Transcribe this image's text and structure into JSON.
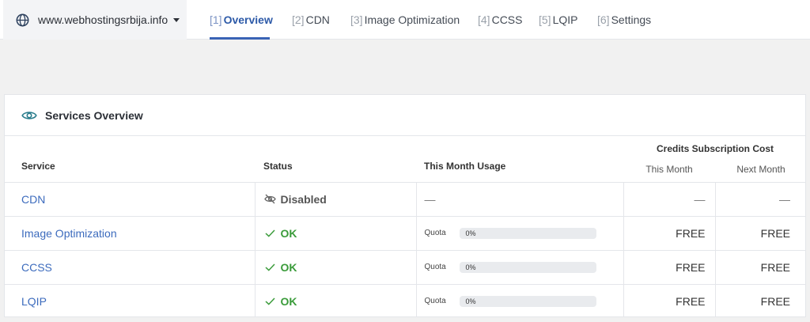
{
  "site": {
    "domain": "www.webhostingsrbija.info",
    "icon": "globe-icon"
  },
  "tabs": [
    {
      "num": "[1]",
      "label": "Overview",
      "active": true
    },
    {
      "num": "[2]",
      "label": "CDN"
    },
    {
      "num": "[3]",
      "label": "Image Optimization"
    },
    {
      "num": "[4]",
      "label": "CCSS"
    },
    {
      "num": "[5]",
      "label": "LQIP"
    },
    {
      "num": "[6]",
      "label": "Settings"
    }
  ],
  "card": {
    "title": "Services Overview",
    "icon": "eye-icon",
    "columns": {
      "service": "Service",
      "status": "Status",
      "usage": "This Month Usage",
      "credits": "Credits Subscription Cost",
      "this_month": "This Month",
      "next_month": "Next Month"
    },
    "rows": [
      {
        "service": "CDN",
        "status": "Disabled",
        "status_type": "disabled",
        "usage": "—",
        "this_month": "—",
        "next_month": "—"
      },
      {
        "service": "Image Optimization",
        "status": "OK",
        "status_type": "ok",
        "quota_label": "Quota",
        "quota_value": "0%",
        "quota_fraction": 0,
        "this_month": "FREE",
        "next_month": "FREE"
      },
      {
        "service": "CCSS",
        "status": "OK",
        "status_type": "ok",
        "quota_label": "Quota",
        "quota_value": "0%",
        "quota_fraction": 0,
        "this_month": "FREE",
        "next_month": "FREE"
      },
      {
        "service": "LQIP",
        "status": "OK",
        "status_type": "ok",
        "quota_label": "Quota",
        "quota_value": "0%",
        "quota_fraction": 0,
        "this_month": "FREE",
        "next_month": "FREE"
      }
    ]
  },
  "colors": {
    "accent": "#3a63b5",
    "link": "#3c6bbd",
    "ok": "#3a9b3a"
  }
}
